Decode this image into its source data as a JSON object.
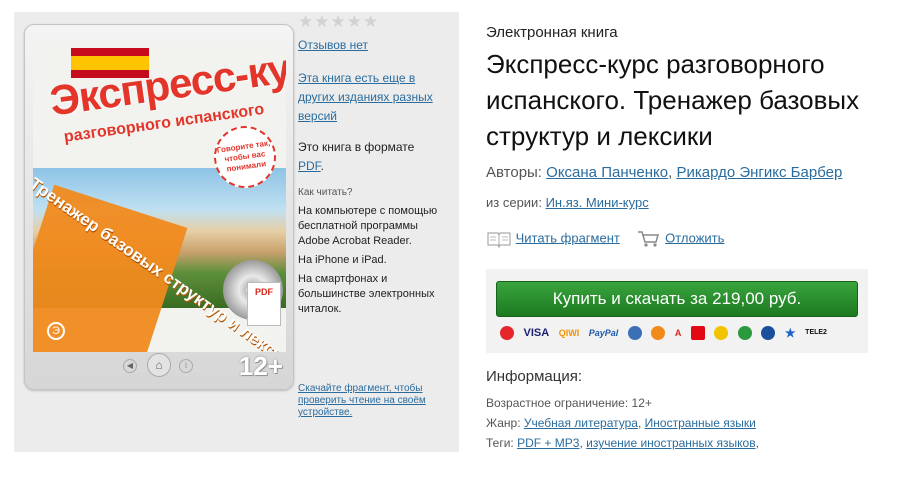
{
  "rating": {
    "stars": "★★★★★",
    "reviews_label": "Отзывов нет"
  },
  "editions_link": "Эта книга есть еще в других изданиях разных версий",
  "format": {
    "prefix": "Это книга в формате",
    "format_link": "PDF",
    "suffix": "."
  },
  "how_to_read": {
    "question": "Как читать?",
    "items": [
      "На компьютере с помощью бесплатной программы Adobe Acrobat Reader.",
      "На iPhone и iPad.",
      "На смартфонах и большинстве электронных читалок."
    ]
  },
  "sample_note": "Скачайте фрагмент, чтобы проверить чтение на своём устройстве.",
  "device": {
    "age_badge": "12+"
  },
  "cover": {
    "title": "Экспресс-курс",
    "subtitle": "разговорного испанского",
    "sticker": "Говорите так, чтобы вас понимали",
    "band": "Тренажер базовых структур и лексики",
    "pdf_label": "PDF",
    "logo": "Э"
  },
  "book": {
    "type": "Электронная книга",
    "title": "Экспресс-курс разговорного испанского. Тренажер базовых структур и лексики",
    "authors_label": "Авторы:",
    "authors": [
      "Оксана Панченко",
      "Рикардо Энгикс Барбер"
    ],
    "series_label": "из серии:",
    "series": "Ин.яз. Мини-курс"
  },
  "actions": {
    "read_sample": "Читать фрагмент",
    "postpone": "Отложить"
  },
  "buy": {
    "button_label": "Купить и скачать за 219,00 руб.",
    "payment_methods": [
      "VISA",
      "QIWI",
      "PayPal",
      "TELE2"
    ]
  },
  "info": {
    "heading": "Информация:",
    "age_label": "Возрастное ограничение:",
    "age_value": "12+",
    "genre_label": "Жанр:",
    "genres": [
      "Учебная литература",
      "Иностранные языки"
    ],
    "tags_label": "Теги:",
    "tags": [
      "PDF + MP3",
      "изучение иностранных языков"
    ]
  },
  "colors": {
    "link": "#2a6c9e",
    "buy_green": "#2a9630",
    "cover_red": "#e3352a",
    "cover_orange": "#f08a1d"
  }
}
